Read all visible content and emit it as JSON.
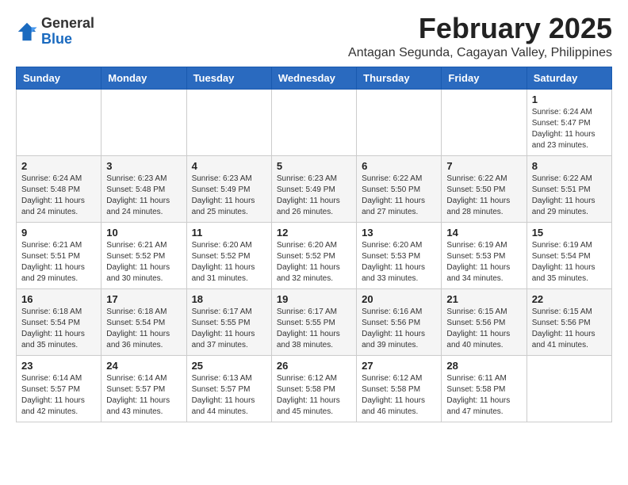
{
  "logo": {
    "general": "General",
    "blue": "Blue"
  },
  "header": {
    "month": "February 2025",
    "location": "Antagan Segunda, Cagayan Valley, Philippines"
  },
  "weekdays": [
    "Sunday",
    "Monday",
    "Tuesday",
    "Wednesday",
    "Thursday",
    "Friday",
    "Saturday"
  ],
  "weeks": [
    [
      {
        "day": "",
        "info": ""
      },
      {
        "day": "",
        "info": ""
      },
      {
        "day": "",
        "info": ""
      },
      {
        "day": "",
        "info": ""
      },
      {
        "day": "",
        "info": ""
      },
      {
        "day": "",
        "info": ""
      },
      {
        "day": "1",
        "info": "Sunrise: 6:24 AM\nSunset: 5:47 PM\nDaylight: 11 hours\nand 23 minutes."
      }
    ],
    [
      {
        "day": "2",
        "info": "Sunrise: 6:24 AM\nSunset: 5:48 PM\nDaylight: 11 hours\nand 24 minutes."
      },
      {
        "day": "3",
        "info": "Sunrise: 6:23 AM\nSunset: 5:48 PM\nDaylight: 11 hours\nand 24 minutes."
      },
      {
        "day": "4",
        "info": "Sunrise: 6:23 AM\nSunset: 5:49 PM\nDaylight: 11 hours\nand 25 minutes."
      },
      {
        "day": "5",
        "info": "Sunrise: 6:23 AM\nSunset: 5:49 PM\nDaylight: 11 hours\nand 26 minutes."
      },
      {
        "day": "6",
        "info": "Sunrise: 6:22 AM\nSunset: 5:50 PM\nDaylight: 11 hours\nand 27 minutes."
      },
      {
        "day": "7",
        "info": "Sunrise: 6:22 AM\nSunset: 5:50 PM\nDaylight: 11 hours\nand 28 minutes."
      },
      {
        "day": "8",
        "info": "Sunrise: 6:22 AM\nSunset: 5:51 PM\nDaylight: 11 hours\nand 29 minutes."
      }
    ],
    [
      {
        "day": "9",
        "info": "Sunrise: 6:21 AM\nSunset: 5:51 PM\nDaylight: 11 hours\nand 29 minutes."
      },
      {
        "day": "10",
        "info": "Sunrise: 6:21 AM\nSunset: 5:52 PM\nDaylight: 11 hours\nand 30 minutes."
      },
      {
        "day": "11",
        "info": "Sunrise: 6:20 AM\nSunset: 5:52 PM\nDaylight: 11 hours\nand 31 minutes."
      },
      {
        "day": "12",
        "info": "Sunrise: 6:20 AM\nSunset: 5:52 PM\nDaylight: 11 hours\nand 32 minutes."
      },
      {
        "day": "13",
        "info": "Sunrise: 6:20 AM\nSunset: 5:53 PM\nDaylight: 11 hours\nand 33 minutes."
      },
      {
        "day": "14",
        "info": "Sunrise: 6:19 AM\nSunset: 5:53 PM\nDaylight: 11 hours\nand 34 minutes."
      },
      {
        "day": "15",
        "info": "Sunrise: 6:19 AM\nSunset: 5:54 PM\nDaylight: 11 hours\nand 35 minutes."
      }
    ],
    [
      {
        "day": "16",
        "info": "Sunrise: 6:18 AM\nSunset: 5:54 PM\nDaylight: 11 hours\nand 35 minutes."
      },
      {
        "day": "17",
        "info": "Sunrise: 6:18 AM\nSunset: 5:54 PM\nDaylight: 11 hours\nand 36 minutes."
      },
      {
        "day": "18",
        "info": "Sunrise: 6:17 AM\nSunset: 5:55 PM\nDaylight: 11 hours\nand 37 minutes."
      },
      {
        "day": "19",
        "info": "Sunrise: 6:17 AM\nSunset: 5:55 PM\nDaylight: 11 hours\nand 38 minutes."
      },
      {
        "day": "20",
        "info": "Sunrise: 6:16 AM\nSunset: 5:56 PM\nDaylight: 11 hours\nand 39 minutes."
      },
      {
        "day": "21",
        "info": "Sunrise: 6:15 AM\nSunset: 5:56 PM\nDaylight: 11 hours\nand 40 minutes."
      },
      {
        "day": "22",
        "info": "Sunrise: 6:15 AM\nSunset: 5:56 PM\nDaylight: 11 hours\nand 41 minutes."
      }
    ],
    [
      {
        "day": "23",
        "info": "Sunrise: 6:14 AM\nSunset: 5:57 PM\nDaylight: 11 hours\nand 42 minutes."
      },
      {
        "day": "24",
        "info": "Sunrise: 6:14 AM\nSunset: 5:57 PM\nDaylight: 11 hours\nand 43 minutes."
      },
      {
        "day": "25",
        "info": "Sunrise: 6:13 AM\nSunset: 5:57 PM\nDaylight: 11 hours\nand 44 minutes."
      },
      {
        "day": "26",
        "info": "Sunrise: 6:12 AM\nSunset: 5:58 PM\nDaylight: 11 hours\nand 45 minutes."
      },
      {
        "day": "27",
        "info": "Sunrise: 6:12 AM\nSunset: 5:58 PM\nDaylight: 11 hours\nand 46 minutes."
      },
      {
        "day": "28",
        "info": "Sunrise: 6:11 AM\nSunset: 5:58 PM\nDaylight: 11 hours\nand 47 minutes."
      },
      {
        "day": "",
        "info": ""
      }
    ]
  ]
}
